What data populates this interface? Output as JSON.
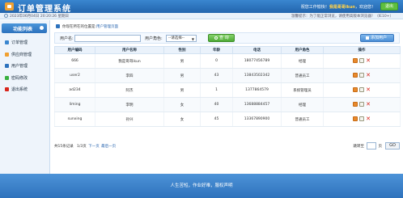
{
  "header": {
    "title": "订单管理系统",
    "welcome_prefix": "祝您工作愉快！",
    "username": "我是哥哥ikun",
    "welcome_suffix": "，欢迎您！",
    "logout_label": "退出"
  },
  "subbar": {
    "datetime": "2023年06月04日 20:20:26 星期日",
    "notice": "温馨提示：为了能正常浏览，请使用高版本浏览器！（IE10+）"
  },
  "sidebar": {
    "title": "功能列表",
    "items": [
      {
        "label": "订单管理",
        "color": "#3a86cf"
      },
      {
        "label": "供应商管理",
        "color": "#f0a030"
      },
      {
        "label": "用户管理",
        "color": "#2d72bd"
      },
      {
        "label": "密码修改",
        "color": "#3ab040"
      },
      {
        "label": "退出系统",
        "color": "#d8261c"
      }
    ]
  },
  "location": {
    "prefix": "你现在所在的位置是:",
    "current": "用户管理页面"
  },
  "search": {
    "name_label": "用户名:",
    "name_value": "",
    "role_label": "用户角色:",
    "role_selected": "--请选择--",
    "query_label": "查 询",
    "add_label": "添加用户"
  },
  "table": {
    "headers": [
      "用户编码",
      "用户名称",
      "性别",
      "年龄",
      "电话",
      "用户角色",
      "操作"
    ],
    "rows": [
      [
        "666",
        "我是哥哥ikun",
        "男",
        "0",
        "18077456789",
        "经理"
      ],
      [
        "user2",
        "李四",
        "男",
        "43",
        "13843502342",
        "普通员工"
      ],
      [
        "ad234",
        "阿杰",
        "男",
        "1",
        "1377864579",
        "系统管理员"
      ],
      [
        "liming",
        "李明",
        "女",
        "40",
        "13688884457",
        "经理"
      ],
      [
        "sunxing",
        "孙兴",
        "女",
        "45",
        "13367890900",
        "普通员工"
      ]
    ]
  },
  "pager": {
    "summary": "共15条记录",
    "pages": "1/3页",
    "next": "下一页",
    "last": "最后一页",
    "jump_label": "跳转至",
    "page_unit": "页",
    "go_label": "GO"
  },
  "footer": {
    "text": "人生苦短，作业好难，服权声明"
  }
}
